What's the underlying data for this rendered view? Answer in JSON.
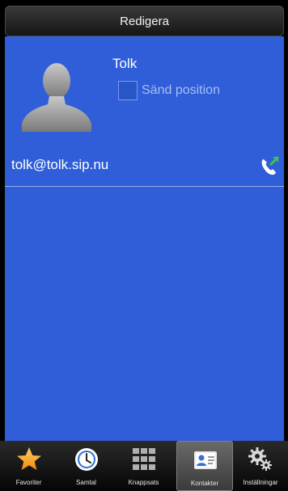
{
  "header": {
    "title": "Redigera"
  },
  "contact": {
    "name": "Tolk",
    "send_position_label": "Sänd position",
    "send_position_checked": false,
    "address": "tolk@tolk.sip.nu"
  },
  "icons": {
    "avatar": "person-silhouette-icon",
    "call": "phone-call-icon"
  },
  "colors": {
    "content_background": "#2f5ed8",
    "header_background": "#1e1e1e",
    "navbar_background": "#111111",
    "call_icon_accent": "#3cc83c"
  },
  "navbar": {
    "active_index": 3,
    "items": [
      {
        "label": "Favoriter",
        "icon": "star-icon"
      },
      {
        "label": "Samtal",
        "icon": "clock-icon"
      },
      {
        "label": "Knappsats",
        "icon": "keypad-icon"
      },
      {
        "label": "Kontakter",
        "icon": "contact-card-icon"
      },
      {
        "label": "Inställningar",
        "icon": "gear-icon"
      }
    ]
  }
}
